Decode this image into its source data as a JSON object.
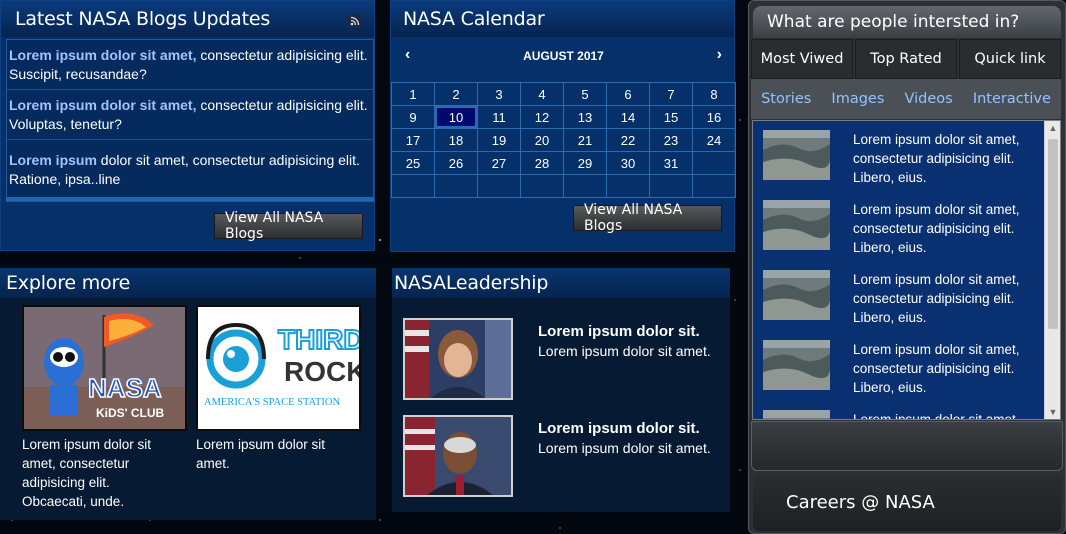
{
  "blogs": {
    "title": "Latest NASA Blogs Updates",
    "rss_icon": "rss-icon",
    "items": [
      {
        "highlight": "Lorem ipsum dolor sit amet,",
        "text": " consectetur adipisicing elit. Suscipit, recusandae?"
      },
      {
        "highlight": "Lorem ipsum dolor sit amet,",
        "text": " consectetur adipisicing elit. Voluptas, tenetur?"
      },
      {
        "highlight": "Lorem ipsum",
        "text": " dolor sit amet, consectetur adipisicing elit. Ratione, ipsa..line"
      }
    ],
    "button": "View All NASA Blogs"
  },
  "calendar": {
    "title": "NASA Calendar",
    "month": "AUGUST 2017",
    "prev": "‹",
    "next": "›",
    "selected_day": "10",
    "weeks": [
      [
        "1",
        "2",
        "3",
        "4",
        "5",
        "6",
        "7",
        "8"
      ],
      [
        "9",
        "10",
        "11",
        "12",
        "13",
        "14",
        "15",
        "16"
      ],
      [
        "17",
        "18",
        "19",
        "20",
        "21",
        "22",
        "23",
        "24"
      ],
      [
        "25",
        "26",
        "27",
        "28",
        "29",
        "30",
        "31",
        ""
      ],
      [
        "",
        "",
        "",
        "",
        "",
        "",
        "",
        ""
      ]
    ],
    "button": "View All NASA Blogs"
  },
  "explore": {
    "title": "Explore more",
    "tiles": [
      {
        "logo_text": "NASA",
        "logo_sub": "KiDS' CLUB",
        "caption": "Lorem ipsum dolor sit amet, consectetur adipisicing elit. Obcaecati, unde."
      },
      {
        "logo_text": "THIRD",
        "logo_text2": "ROCK",
        "logo_sub": "AMERICA'S SPACE STATION",
        "caption": "Lorem ipsum dolor sit amet."
      }
    ]
  },
  "leadership": {
    "title": "NASALeadership",
    "people": [
      {
        "name": "Lorem ipsum dolor sit.",
        "sub": "Lorem ipsum dolor sit amet."
      },
      {
        "name": "Lorem ipsum dolor sit.",
        "sub": "Lorem ipsum dolor sit amet."
      }
    ]
  },
  "interests": {
    "title": "What are people intersted in?",
    "main_tabs": [
      "Most Viwed",
      "Top Rated",
      "Quick link"
    ],
    "sub_tabs": [
      "Stories",
      "Images",
      "Videos",
      "Interactive"
    ],
    "feed": [
      "Lorem ipsum dolor sit amet, consectetur adipisicing elit. Libero, eius.",
      "Lorem ipsum dolor sit amet, consectetur adipisicing elit. Libero, eius.",
      "Lorem ipsum dolor sit amet, consectetur adipisicing elit. Libero, eius.",
      "Lorem ipsum dolor sit amet, consectetur adipisicing elit. Libero, eius.",
      "Lorem ipsum dolor sit amet, consectetur adipisicing elit. Libero, eius."
    ],
    "careers": "Careers @ NASA"
  }
}
